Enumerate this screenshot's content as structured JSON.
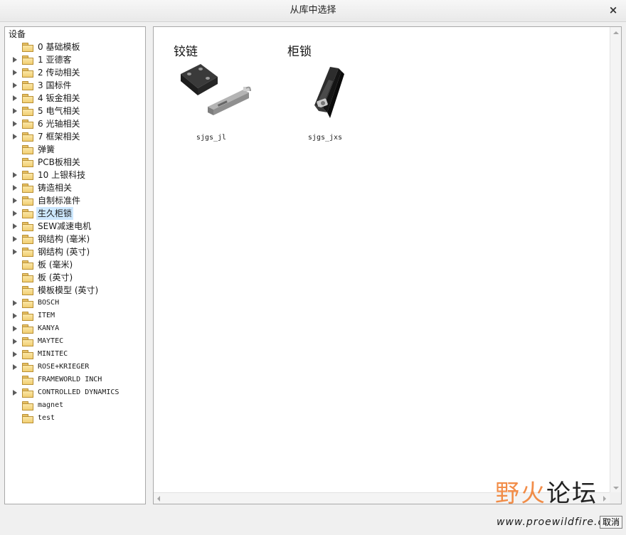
{
  "window": {
    "title": "从库中选择",
    "close_glyph": "×"
  },
  "tree": {
    "root_label": "设备",
    "items": [
      {
        "label": "0 基础模板",
        "expandable": false,
        "mono": false,
        "selected": false
      },
      {
        "label": "1 亚德客",
        "expandable": true,
        "mono": false,
        "selected": false
      },
      {
        "label": "2 传动相关",
        "expandable": true,
        "mono": false,
        "selected": false
      },
      {
        "label": "3 国标件",
        "expandable": true,
        "mono": false,
        "selected": false
      },
      {
        "label": "4 钣金相关",
        "expandable": true,
        "mono": false,
        "selected": false
      },
      {
        "label": "5 电气相关",
        "expandable": true,
        "mono": false,
        "selected": false
      },
      {
        "label": "6 光轴相关",
        "expandable": true,
        "mono": false,
        "selected": false
      },
      {
        "label": "7 框架相关",
        "expandable": true,
        "mono": false,
        "selected": false
      },
      {
        "label": "弹簧",
        "expandable": false,
        "mono": false,
        "selected": false
      },
      {
        "label": "PCB板相关",
        "expandable": false,
        "mono": false,
        "selected": false
      },
      {
        "label": "10 上银科技",
        "expandable": true,
        "mono": false,
        "selected": false
      },
      {
        "label": "铸造相关",
        "expandable": true,
        "mono": false,
        "selected": false
      },
      {
        "label": "自制标准件",
        "expandable": true,
        "mono": false,
        "selected": false
      },
      {
        "label": "生久柜锁",
        "expandable": true,
        "mono": false,
        "selected": true
      },
      {
        "label": "SEW减速电机",
        "expandable": true,
        "mono": false,
        "selected": false
      },
      {
        "label": "钢结构 (毫米)",
        "expandable": true,
        "mono": false,
        "selected": false
      },
      {
        "label": "钢结构 (英寸)",
        "expandable": true,
        "mono": false,
        "selected": false
      },
      {
        "label": "板 (毫米)",
        "expandable": false,
        "mono": false,
        "selected": false
      },
      {
        "label": "板 (英寸)",
        "expandable": false,
        "mono": false,
        "selected": false
      },
      {
        "label": "模板模型 (英寸)",
        "expandable": false,
        "mono": false,
        "selected": false
      },
      {
        "label": "BOSCH",
        "expandable": true,
        "mono": true,
        "selected": false
      },
      {
        "label": "ITEM",
        "expandable": true,
        "mono": true,
        "selected": false
      },
      {
        "label": "KANYA",
        "expandable": true,
        "mono": true,
        "selected": false
      },
      {
        "label": "MAYTEC",
        "expandable": true,
        "mono": true,
        "selected": false
      },
      {
        "label": "MINITEC",
        "expandable": true,
        "mono": true,
        "selected": false
      },
      {
        "label": "ROSE+KRIEGER",
        "expandable": true,
        "mono": true,
        "selected": false
      },
      {
        "label": "FRAMEWORLD INCH",
        "expandable": false,
        "mono": true,
        "selected": false
      },
      {
        "label": "CONTROLLED DYNAMICS",
        "expandable": true,
        "mono": true,
        "selected": false
      },
      {
        "label": "magnet",
        "expandable": false,
        "mono": true,
        "selected": false
      },
      {
        "label": "test",
        "expandable": false,
        "mono": true,
        "selected": false
      }
    ]
  },
  "content": {
    "tiles": [
      {
        "title": "铰链",
        "filename": "sjgs_jl",
        "icon": "hinge-icon"
      },
      {
        "title": "柜锁",
        "filename": "sjgs_jxs",
        "icon": "cabinet-lock-icon"
      }
    ]
  },
  "buttons": {
    "cancel_label": "取消"
  },
  "watermark": {
    "text_a": "野火",
    "text_b": "论坛",
    "url": "www.proewildfire.cn"
  },
  "colors": {
    "selected_bg": "#cde8ff",
    "folder": "#f1cf73",
    "watermark_accent": "#f07a2a"
  }
}
